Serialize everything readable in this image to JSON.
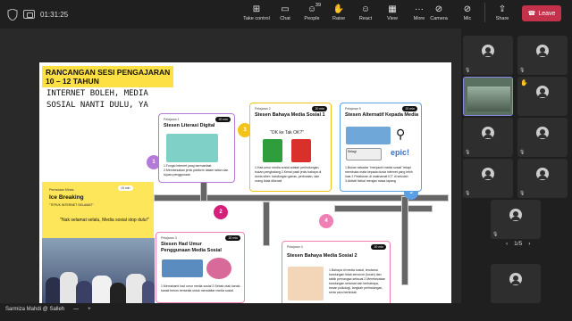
{
  "topbar": {
    "timer": "01:31:25",
    "buttons": [
      {
        "label": "Take control",
        "icon": "take-control-icon"
      },
      {
        "label": "Chat",
        "icon": "chat-icon"
      },
      {
        "label": "People",
        "icon": "people-icon",
        "badge": "39"
      },
      {
        "label": "Raise",
        "icon": "raise-hand-icon"
      },
      {
        "label": "React",
        "icon": "react-icon"
      },
      {
        "label": "View",
        "icon": "view-icon"
      },
      {
        "label": "More",
        "icon": "more-icon"
      }
    ],
    "camera_label": "Camera",
    "mic_label": "Mic",
    "share_label": "Share",
    "leave_label": "Leave"
  },
  "slide": {
    "title_line1": "RANCANGAN SESI PENGAJARAN",
    "title_line2": "10 – 12  TAHUN",
    "subtitle": "INTERNET BOLEH, MEDIA SOSIAL NANTI DULU, YA",
    "ice": {
      "small": "Permulaan Minda",
      "title": "Ice Breaking",
      "sub": "\"TEPUK INTERNET SELAMAT\"",
      "quote": "\"Nak selamat selalu, Media sosial stop dulu!\"",
      "time": "15 min"
    },
    "cards": [
      {
        "label": "Pelajaran 1",
        "title": "Stesen Literasi Digital",
        "time": "20 min",
        "body": "1.Fungsi internet yang bermanfaat 2.Membezakan jenis platform dalam talian dan tujuan penggunaan"
      },
      {
        "label": "Pelajaran 2",
        "title": "Stesen Bahaya Media Sosial 1",
        "time": "20 min",
        "quote": "\"OK ke Tak OK?\"",
        "body": "1.Had umur media sosial adalah perlindungan, bukan penghalang 2.Kenal pasti jenis bahaya di dunia siber: kandungan ganas, perbualan, dan orang tidak dikenali"
      },
      {
        "label": "Pelajaran 5",
        "title": "Stesen Alternatif Kepada Media",
        "time": "20 min",
        "body": "1.Bukan sekadar \"menjauhi media sosial\" tetapi membuka mata kepada dunia internet yang lebih luas 2.Pelaburan di maknamat ICT di sekolah 3.Aktiviti fizikal mengisi masa lapang"
      },
      {
        "label": "Pelajaran 3",
        "title": "Stesen Had Umur Penggunaan Media Sosial",
        "time": "20 min",
        "body": "1.Memahami had umur media sosial 2.Sebab otak kanak-kanak belum bersedia untuk mendaftar media sosial"
      },
      {
        "label": "Pelajaran 4",
        "title": "Stesen Bahaya Media Sosial 2",
        "time": "20 min",
        "body": "1.Bahaya di media sosial, terutama kandungan tidak senonoh (lucah) dan taktik pemangsa seksual 2.Membezakan kandungan selamat dan berbahaya, kesan psikologi, langkah perlindungan, serta cara bertindak"
      }
    ],
    "nodes": [
      "1",
      "2",
      "3",
      "4",
      "5"
    ],
    "logo_text": "epic!",
    "screen_text": "Selagi"
  },
  "gallery": {
    "pager": "1/5"
  },
  "bottombar": {
    "name": "Sarmiza Mahdi @ Salleh"
  },
  "colors": {
    "leave": "#c4314b",
    "slide_yellow": "#fde043",
    "card_purple": "#b57ad8",
    "card_yellow": "#f3c21b",
    "card_blue": "#5aa0e6",
    "card_pink": "#f07fb6",
    "selected_tile": "#8a86e6"
  }
}
